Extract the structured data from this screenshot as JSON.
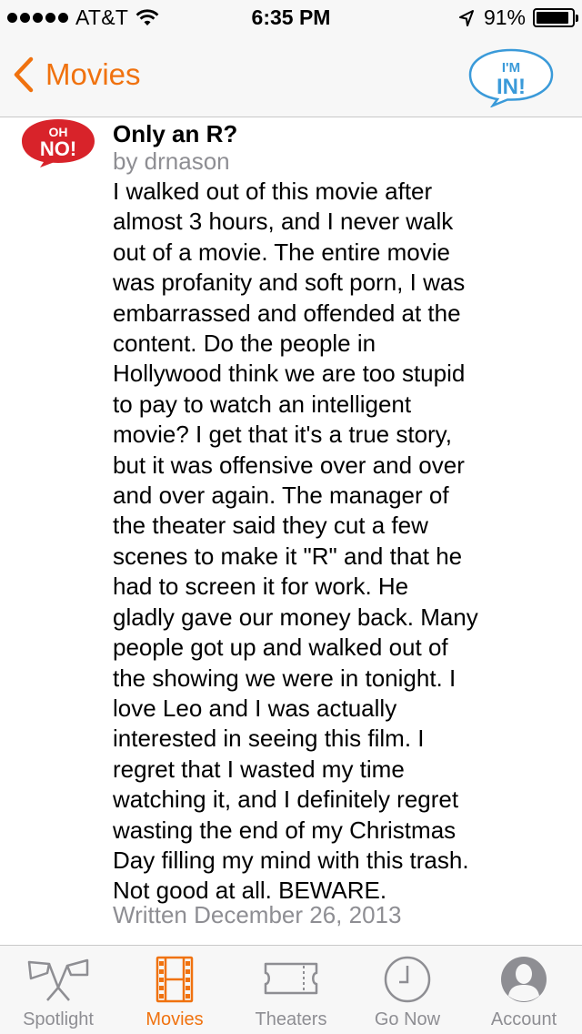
{
  "status_bar": {
    "carrier": "AT&T",
    "time": "6:35 PM",
    "battery_percent": "91%",
    "battery_level": 0.91,
    "signal_bars": 5
  },
  "nav": {
    "back_label": "Movies",
    "im_in_top": "I'M",
    "im_in_bottom": "IN!",
    "accent_color": "#f0720f",
    "im_in_color": "#3a9ad9"
  },
  "review": {
    "badge_top": "OH",
    "badge_bottom": "NO!",
    "badge_color": "#d8232a",
    "title": "Only an R?",
    "author": "by drnason",
    "body": "I walked out of this movie after\nalmost 3 hours, and I never walk\nout of a movie.  The entire movie\nwas profanity and soft porn, I was\nembarrassed and offended at the\ncontent.  Do the people in\nHollywood think we are too stupid\nto pay to watch an intelligent\nmovie?  I get that it's a true story,\nbut it was offensive over and over\nand over again.  The manager of\nthe theater said they cut a few\nscenes to make it \"R\" and that he\nhad to screen it for work.  He\ngladly gave our money back.  Many\npeople got up and walked out of\nthe showing we were in tonight.  I\nlove Leo and I was actually\ninterested in seeing this film.  I\nregret that I wasted my time\nwatching it, and I definitely regret\nwasting the end of my Christmas\nDay filling my mind with this trash.\nNot good at all.  BEWARE.",
    "date": "Written December 26, 2013"
  },
  "tab_bar": {
    "tabs": [
      {
        "label": "Spotlight",
        "icon": "spotlight-icon",
        "active": false
      },
      {
        "label": "Movies",
        "icon": "film-icon",
        "active": true
      },
      {
        "label": "Theaters",
        "icon": "ticket-icon",
        "active": false
      },
      {
        "label": "Go Now",
        "icon": "clock-icon",
        "active": false
      },
      {
        "label": "Account",
        "icon": "user-icon",
        "active": false
      }
    ]
  }
}
